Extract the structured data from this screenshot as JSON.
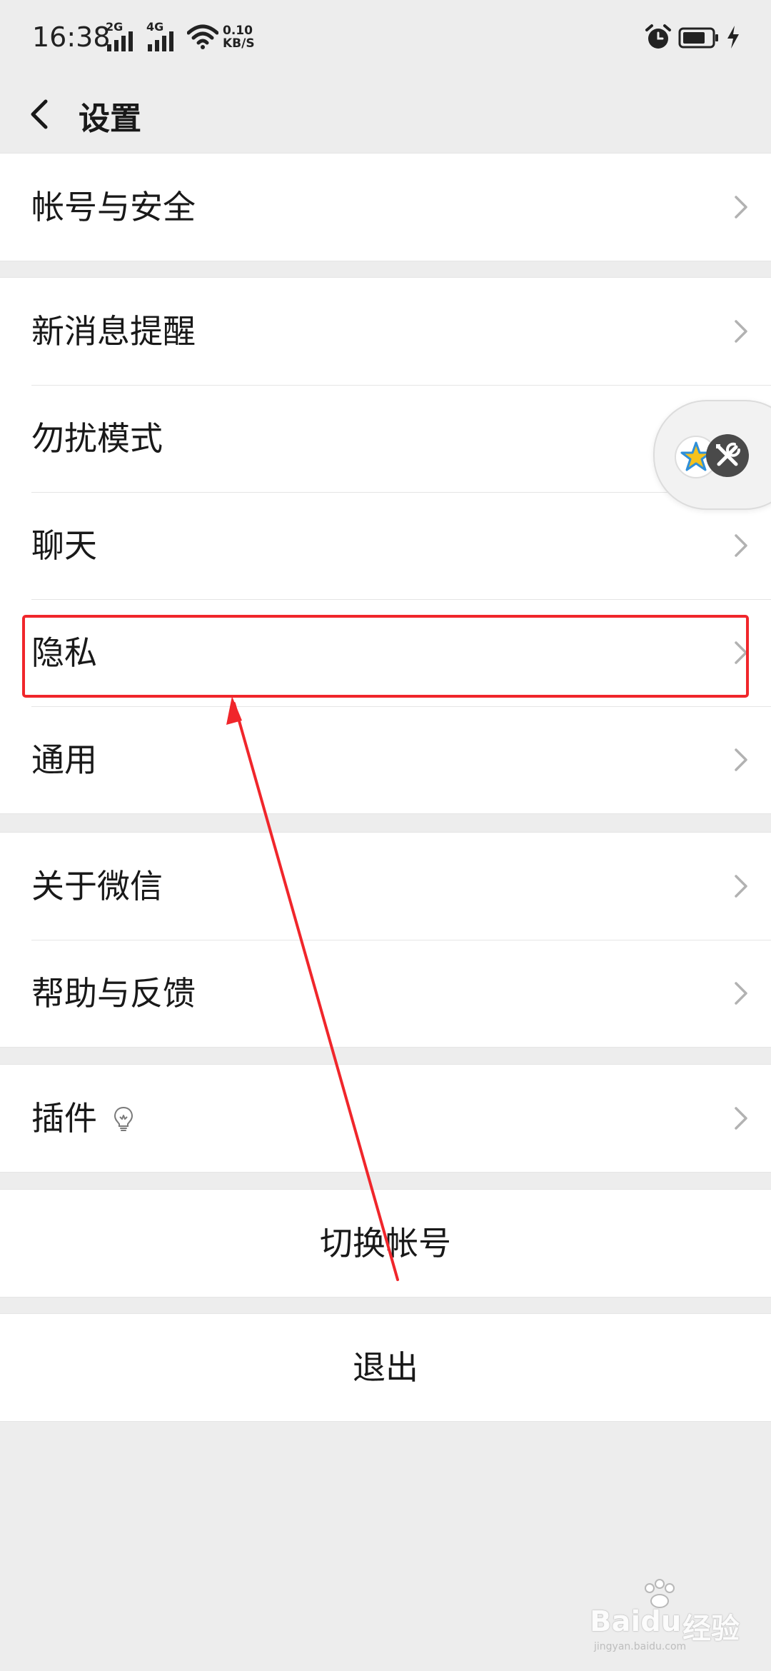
{
  "status_bar": {
    "time": "16:38",
    "network_1": "2G",
    "network_2": "4G",
    "speed_value": "0.10",
    "speed_unit": "KB/S"
  },
  "header": {
    "title": "设置"
  },
  "menu": {
    "account_security": "帐号与安全",
    "new_message_alert": "新消息提醒",
    "do_not_disturb": "勿扰模式",
    "chat": "聊天",
    "privacy": "隐私",
    "general": "通用",
    "about_wechat": "关于微信",
    "help_feedback": "帮助与反馈",
    "plugins": "插件",
    "switch_account": "切换帐号",
    "logout": "退出"
  },
  "watermark": {
    "brand": "Baidu",
    "product": "经验",
    "url": "jingyan.baidu.com"
  },
  "colors": {
    "background": "#EDEDED",
    "row_background": "#FFFFFF",
    "text": "#191919",
    "chevron": "#B2B2B2",
    "highlight": "#F0262B"
  },
  "icons": {
    "back": "chevron-left-icon",
    "row_arrow": "chevron-right-icon",
    "plugin": "lightbulb-icon",
    "floating_ball": "star-icon, tools-icon"
  }
}
